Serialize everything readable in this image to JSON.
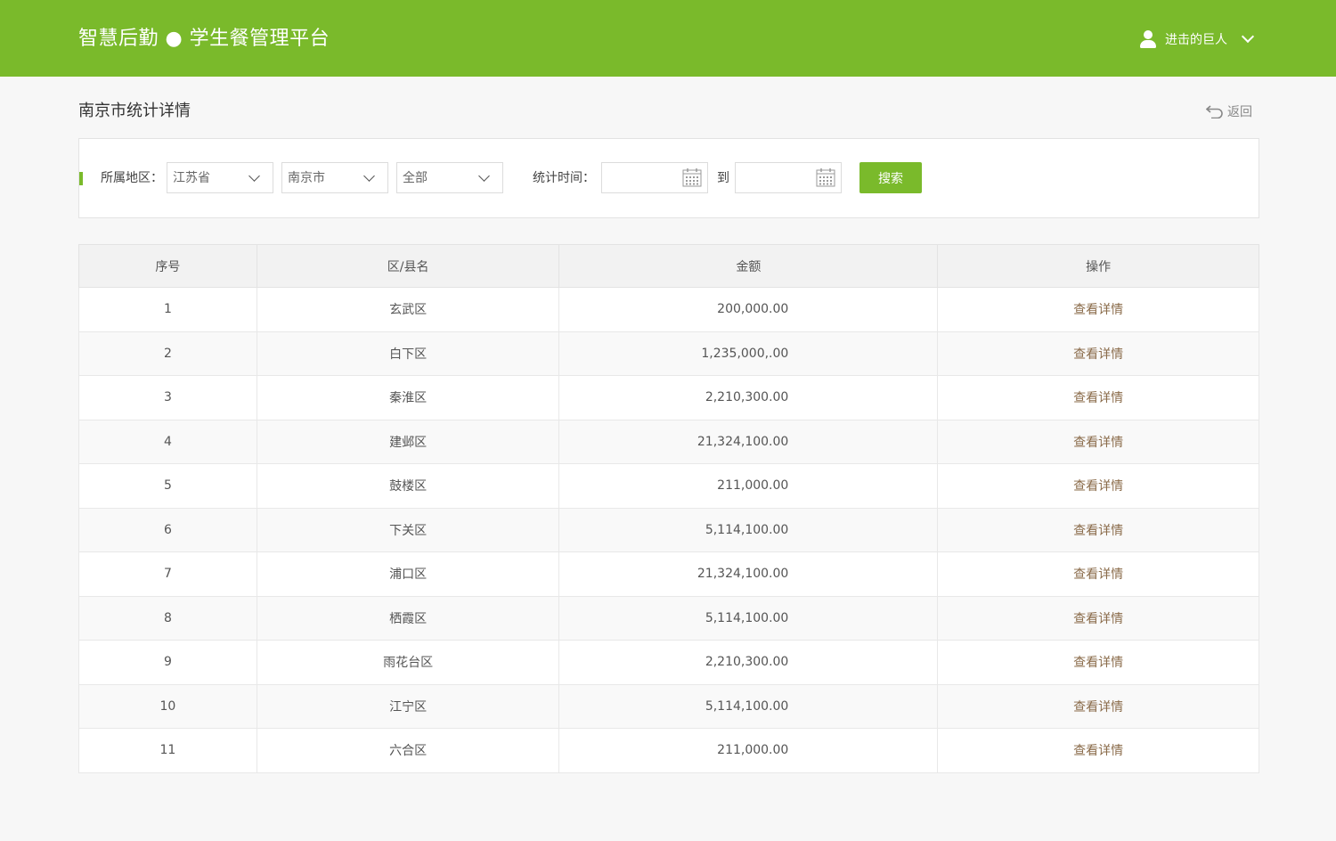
{
  "header": {
    "brand": "智慧后勤 ● 学生餐管理平台",
    "user_name": "进击的巨人",
    "user_icon": "user-icon",
    "dropdown_icon": "chevron-down-icon"
  },
  "page": {
    "title": "南京市统计详情",
    "back_label": "返回",
    "back_icon": "return-arrow-icon"
  },
  "filter": {
    "region_label": "所属地区：",
    "province": "江苏省",
    "city": "南京市",
    "district": "全部",
    "time_label": "统计时间：",
    "start_date": "",
    "to_label": "到",
    "end_date": "",
    "calendar_icon": "calendar-icon",
    "search_label": "搜索"
  },
  "table": {
    "headers": [
      "序号",
      "区/县名",
      "金额",
      "操作"
    ],
    "rows": [
      {
        "no": "1",
        "name": "玄武区",
        "amount": "200,000.00",
        "action": "查看详情"
      },
      {
        "no": "2",
        "name": "白下区",
        "amount": "1,235,000,.00",
        "action": "查看详情"
      },
      {
        "no": "3",
        "name": "秦淮区",
        "amount": "2,210,300.00",
        "action": "查看详情"
      },
      {
        "no": "4",
        "name": "建邺区",
        "amount": "21,324,100.00",
        "action": "查看详情"
      },
      {
        "no": "5",
        "name": "鼓楼区",
        "amount": "211,000.00",
        "action": "查看详情"
      },
      {
        "no": "6",
        "name": "下关区",
        "amount": "5,114,100.00",
        "action": "查看详情"
      },
      {
        "no": "7",
        "name": "浦口区",
        "amount": "21,324,100.00",
        "action": "查看详情"
      },
      {
        "no": "8",
        "name": "栖霞区",
        "amount": "5,114,100.00",
        "action": "查看详情"
      },
      {
        "no": "9",
        "name": "雨花台区",
        "amount": "2,210,300.00",
        "action": "查看详情"
      },
      {
        "no": "10",
        "name": "江宁区",
        "amount": "5,114,100.00",
        "action": "查看详情"
      },
      {
        "no": "11",
        "name": "六合区",
        "amount": "211,000.00",
        "action": "查看详情"
      }
    ]
  },
  "colors": {
    "brand_green": "#7aba2b",
    "link_brown": "#8a6b4a",
    "page_bg": "#f7f7f7"
  }
}
